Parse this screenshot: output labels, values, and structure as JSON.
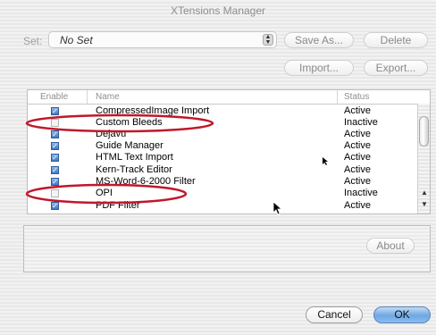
{
  "window": {
    "title": "XTensions Manager"
  },
  "set": {
    "label": "Set:",
    "value": "No Set"
  },
  "buttons": {
    "save_as": "Save As...",
    "delete": "Delete",
    "import": "Import...",
    "export": "Export...",
    "about": "About",
    "cancel": "Cancel",
    "ok": "OK"
  },
  "list": {
    "columns": [
      "Enable",
      "Name",
      "Status"
    ],
    "rows": [
      {
        "name": "CompressedImage Import",
        "status": "Active",
        "enabled": true
      },
      {
        "name": "Custom Bleeds",
        "status": "Inactive",
        "enabled": false
      },
      {
        "name": "Dejavu",
        "status": "Active",
        "enabled": true
      },
      {
        "name": "Guide Manager",
        "status": "Active",
        "enabled": true
      },
      {
        "name": "HTML Text Import",
        "status": "Active",
        "enabled": true
      },
      {
        "name": "Kern-Track Editor",
        "status": "Active",
        "enabled": true
      },
      {
        "name": "MS-Word-6-2000 Filter",
        "status": "Active",
        "enabled": true
      },
      {
        "name": "OPI",
        "status": "Inactive",
        "enabled": false
      },
      {
        "name": "PDF Filter",
        "status": "Active",
        "enabled": true
      }
    ]
  },
  "colors": {
    "highlight_ellipse": "#c0182b",
    "checkbox_blue": "#3f77c4",
    "ok_button": "#6ea7e3"
  },
  "icons": {
    "checkbox": "checkmark-glyph",
    "popup_arrow": "up-down-chevron-icon",
    "cursor": "arrow-pointer-icon"
  }
}
